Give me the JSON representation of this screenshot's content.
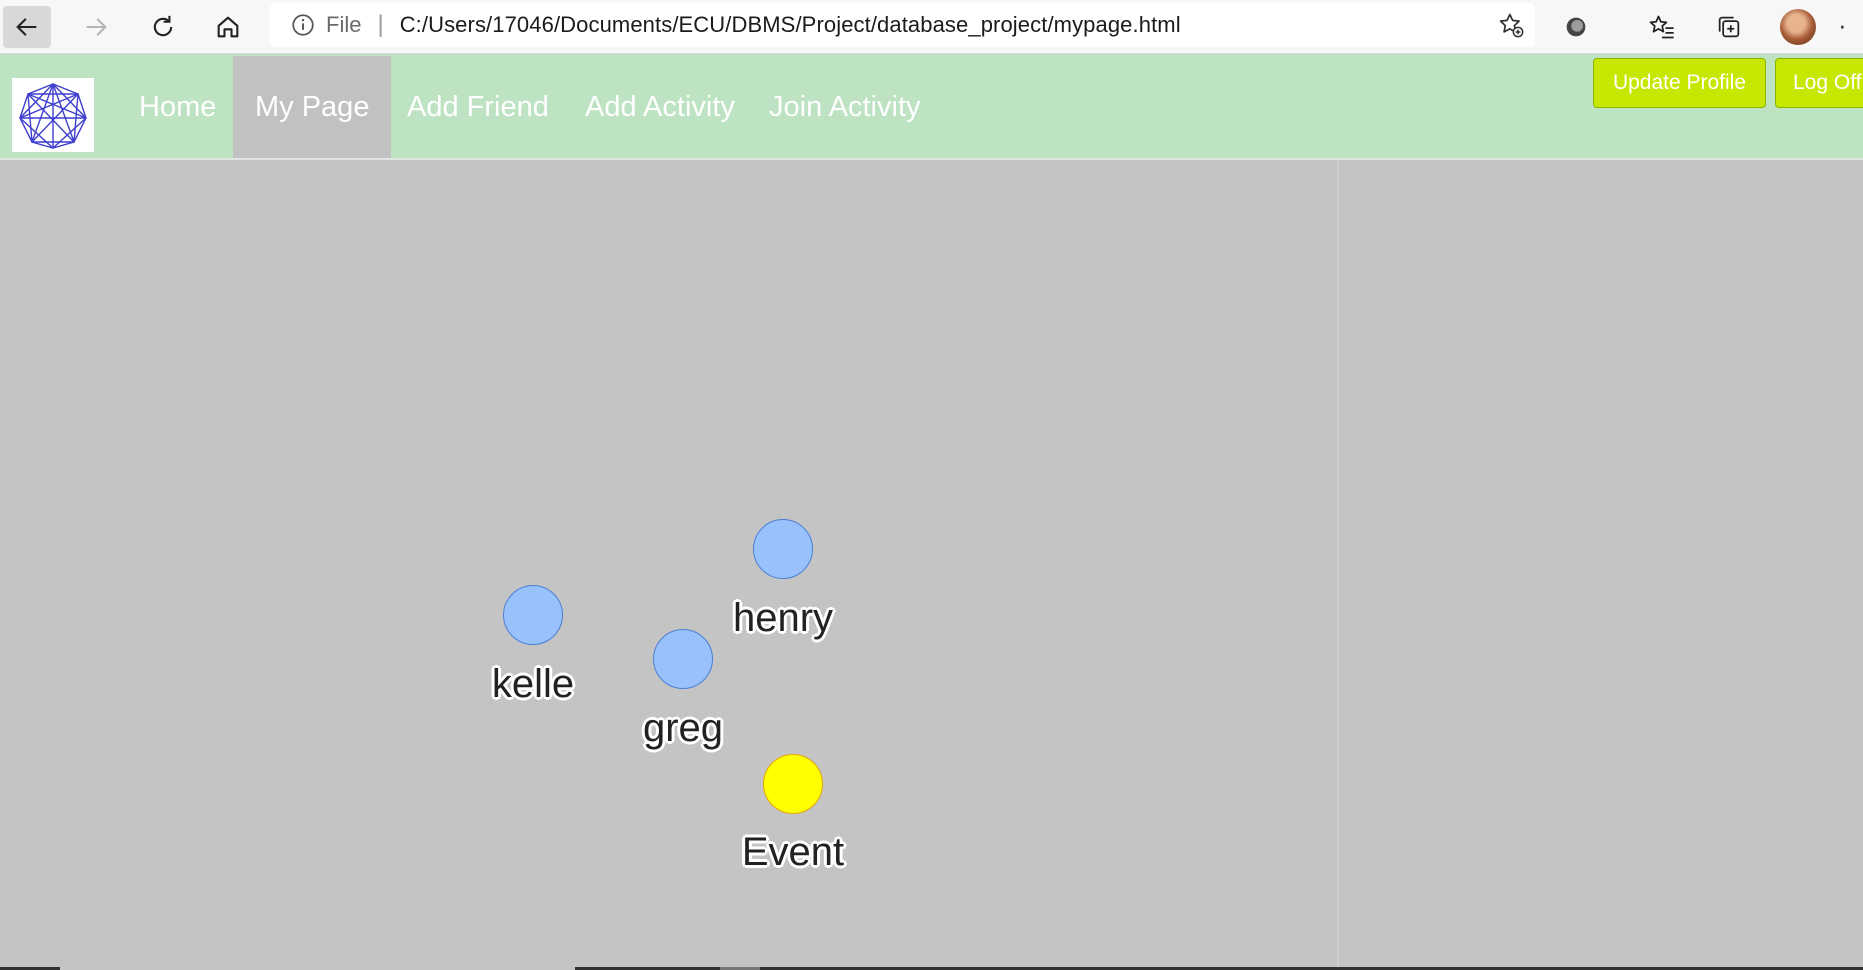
{
  "browser": {
    "address_scheme": "File",
    "address_separator": "|",
    "url": "C:/Users/17046/Documents/ECU/DBMS/Project/database_project/mypage.html"
  },
  "nav": {
    "items": [
      {
        "label": "Home",
        "active": false
      },
      {
        "label": "My Page",
        "active": true
      },
      {
        "label": "Add Friend",
        "active": false
      },
      {
        "label": "Add Activity",
        "active": false
      },
      {
        "label": "Join Activity",
        "active": false
      }
    ],
    "update_profile_label": "Update Profile",
    "log_off_label": "Log Off"
  },
  "graph": {
    "nodes": [
      {
        "label": "henry",
        "type": "friend"
      },
      {
        "label": "kelle",
        "type": "friend"
      },
      {
        "label": "greg",
        "type": "friend"
      },
      {
        "label": "Event",
        "type": "event"
      }
    ]
  },
  "colors": {
    "navbar_bg": "#bde3c3",
    "button_green": "#c6e700",
    "friend_node": "#99c1fc",
    "friend_border": "#4a7fd6",
    "event_node": "#ffff00",
    "event_border": "#e5a800",
    "canvas_bg": "#c4c4c4"
  }
}
